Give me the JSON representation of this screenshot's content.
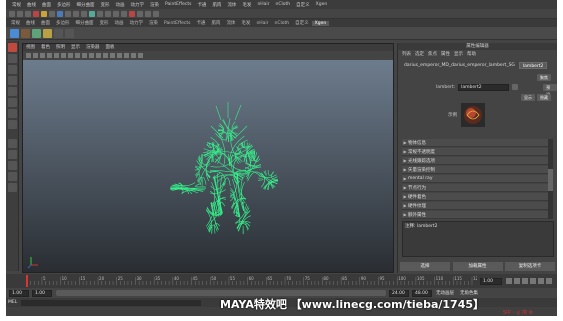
{
  "menubar": {
    "items": [
      "常规",
      "曲线",
      "曲面",
      "多边形",
      "细分曲面",
      "变形",
      "动画",
      "动力学",
      "渲染",
      "PaintEffects",
      "卡通",
      "肌肉",
      "流体",
      "毛发",
      "nHair",
      "nCloth",
      "自定义",
      "Xgen"
    ]
  },
  "shelf": {
    "tabs": [
      "常规",
      "曲线",
      "曲面",
      "多边形",
      "细分曲面",
      "变形",
      "动画",
      "动力学",
      "渲染",
      "PaintEffects",
      "卡通",
      "肌肉",
      "流体",
      "毛发",
      "nHair",
      "nCloth",
      "自定义",
      "Xgen"
    ],
    "active_tab": "Xgen"
  },
  "viewport": {
    "menu": [
      "视图",
      "着色",
      "照明",
      "显示",
      "渲染器",
      "面板"
    ]
  },
  "attribute_editor": {
    "title": "属性编辑器",
    "menu": [
      "列表",
      "选定",
      "焦点",
      "属性",
      "显示",
      "帮助"
    ],
    "node_path": "darius_emperor_MD_darius_emperor_lambert_SG",
    "node_tab": "lambert2",
    "focus_button": "聚焦",
    "presets_button": "预设",
    "show_button": "显示",
    "hide_button": "隐藏",
    "type_label": "lambert:",
    "type_value": "lambert2",
    "sample_label": "示例",
    "sections": [
      "物体信息",
      "常规不透明度",
      "光线跟踪选项",
      "矢量渲染控制",
      "mental ray",
      "节点行为",
      "硬件着色",
      "硬件纹理",
      "额外属性"
    ],
    "notes_label": "注释:",
    "notes_value": "lambert2",
    "buttons": [
      "选择",
      "加载属性",
      "复制选项卡"
    ]
  },
  "timeline": {
    "ticks": [
      "5",
      "10",
      "15",
      "20",
      "25",
      "30",
      "35",
      "40",
      "45",
      "50",
      "55",
      "60",
      "65",
      "70",
      "75",
      "80",
      "85",
      "90",
      "95",
      "100",
      "105",
      "110",
      "115",
      "120"
    ],
    "current_frame": "1.00"
  },
  "range": {
    "start": "1.00",
    "inner_start": "1.00",
    "current": "1",
    "end": "24.00",
    "outer_end": "48.00",
    "anim_layer": "无动画层",
    "char_set": "无角色集"
  },
  "command_line": {
    "label": "MEL"
  },
  "watermark": {
    "text": "MAYA特效吧 【www.linecg.com/tieba/1745】"
  },
  "logo": {
    "text": "S中・◎ 简 ⚙"
  },
  "colors": {
    "selection_green": "#35f08a",
    "accent_red": "#c04a3e"
  }
}
